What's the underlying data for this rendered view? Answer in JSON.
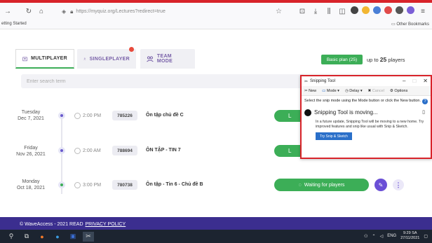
{
  "browser": {
    "url": "https://myquiz.org/Lectures?redirect=true",
    "bookmark_left": "etting Started",
    "bookmark_right": "Other Bookmarks"
  },
  "tabs": [
    {
      "label": "MULTIPLAYER"
    },
    {
      "label": "SINGLEPLAYER"
    },
    {
      "label": "TEAM MODE"
    }
  ],
  "plan": {
    "button": "Basic plan (25)",
    "text_prefix": "up to",
    "players_count": "25",
    "text_suffix": "players"
  },
  "search": {
    "placeholder": "Enter search term"
  },
  "sessions": [
    {
      "day": "Tuesday",
      "date": "Dec 7, 2021",
      "time": "2:00 PM",
      "code": "785226",
      "title": "Ôn tập chủ đề C",
      "action": "L"
    },
    {
      "day": "Friday",
      "date": "Nov 26, 2021",
      "time": "2:00 AM",
      "code": "788694",
      "title": "ÔN TẬP - TIN 7",
      "action": "L"
    },
    {
      "day": "Monday",
      "date": "Oct 18, 2021",
      "time": "3:00 PM",
      "code": "780738",
      "title": "Ôn tập - Tin 6 - Chủ đề B",
      "action": "Waiting for players"
    }
  ],
  "footer": {
    "copyright": "© WaveAccess - 2021",
    "read": "READ",
    "policy": "PRIVACY POLICY"
  },
  "snipping": {
    "title": "Snipping Tool",
    "new": "New",
    "mode": "Mode",
    "delay": "Delay",
    "cancel": "Cancel",
    "options": "Options",
    "instructions": "Select the snip mode using the Mode button or click the New button.",
    "moving_title": "Snipping Tool is moving...",
    "moving_desc": "In a future update, Snipping Tool will be moving to a new home. Try improved features and snip like usual with Snip & Sketch.",
    "try_button": "Try Snip & Sketch"
  },
  "taskbar": {
    "lang": "ENG",
    "time": "9:29 SA",
    "date": "27/11/2021"
  }
}
